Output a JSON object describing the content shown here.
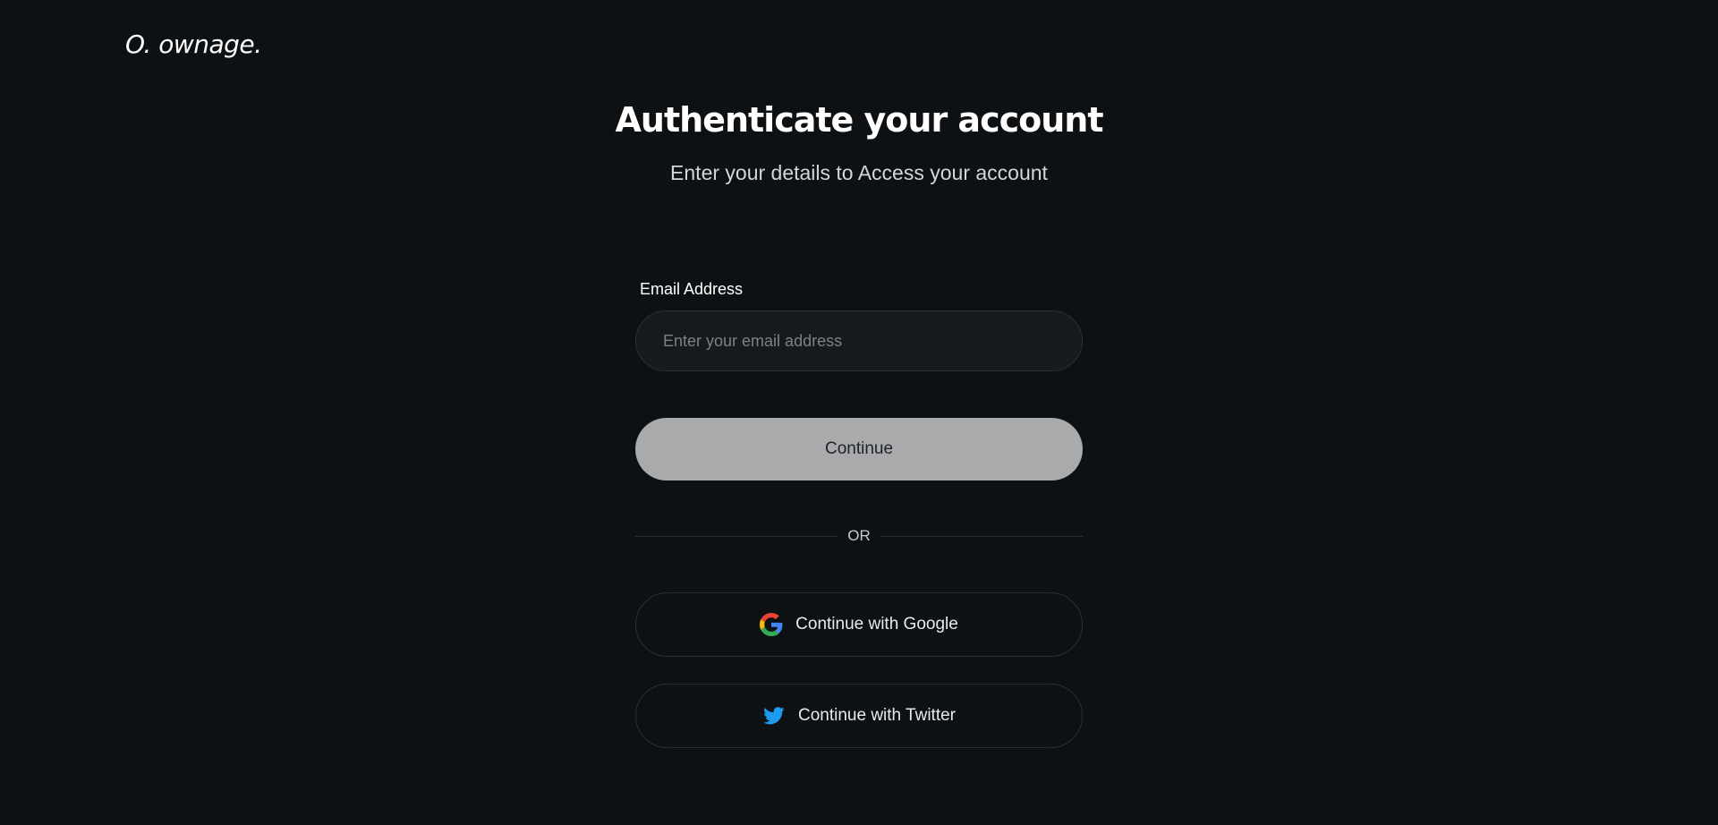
{
  "brand": {
    "logo_text": "O. ownage."
  },
  "header": {
    "title": "Authenticate your account",
    "subtitle": "Enter your details to Access your account"
  },
  "form": {
    "email_label": "Email Address",
    "email_placeholder": "Enter your email address",
    "email_value": "",
    "continue_label": "Continue",
    "divider_text": "OR"
  },
  "social": {
    "google_label": "Continue with Google",
    "google_icon": "google-icon",
    "twitter_label": "Continue with Twitter",
    "twitter_icon": "twitter-icon"
  },
  "colors": {
    "background": "#0e1114",
    "input_background": "#16191d",
    "continue_button": "#a9aaab",
    "twitter_blue": "#1d9bf0"
  }
}
